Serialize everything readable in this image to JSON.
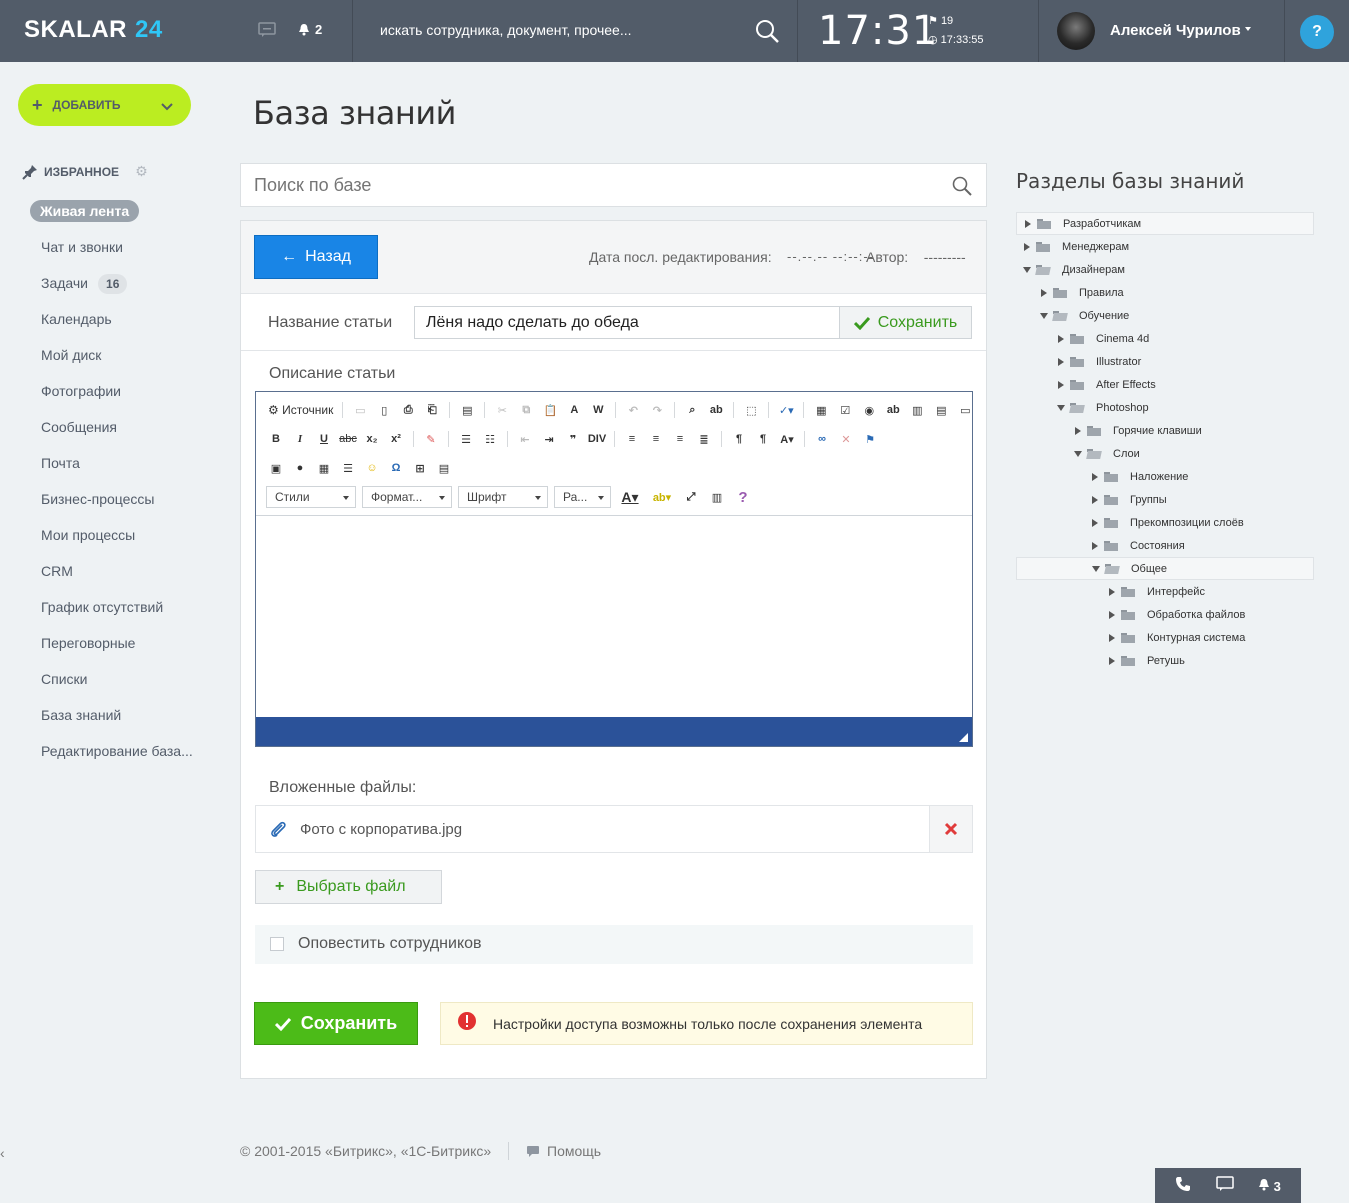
{
  "header": {
    "logo_text": "SKALAR",
    "logo_number": "24",
    "notifications_count": "2",
    "search_placeholder": "искать сотрудника, документ, прочее...",
    "clock": "17:31",
    "flag_count": "19",
    "timer": "17:33:55",
    "user_name": "Алексей Чурилов",
    "help_label": "?"
  },
  "sidebar": {
    "add_button": "ДОБАВИТЬ",
    "favorites_label": "ИЗБРАННОЕ",
    "items": [
      {
        "label": "Живая лента",
        "active": true
      },
      {
        "label": "Чат и звонки"
      },
      {
        "label": "Задачи",
        "counter": "16"
      },
      {
        "label": "Календарь"
      },
      {
        "label": "Мой диск"
      },
      {
        "label": "Фотографии"
      },
      {
        "label": "Сообщения"
      },
      {
        "label": "Почта"
      },
      {
        "label": "Бизнес-процессы"
      },
      {
        "label": "Мои процессы"
      },
      {
        "label": "CRM"
      },
      {
        "label": "График отсутствий"
      },
      {
        "label": "Переговорные"
      },
      {
        "label": "Списки"
      },
      {
        "label": "База знаний"
      },
      {
        "label": "Редактирование база..."
      }
    ]
  },
  "main": {
    "title": "База знаний",
    "search_placeholder": "Поиск по базе",
    "back_button": "Назад",
    "last_edit_label": "Дата посл. редактирования:",
    "last_edit_value": "--.--.-- --:--:--",
    "author_label": "Автор:",
    "author_value": "---------",
    "article_title_label": "Название статьи",
    "article_title_value": "Лёня надо сделать до обеда",
    "save_small": "Сохранить",
    "description_label": "Описание статьи",
    "editor": {
      "source_label": "Источник",
      "styles": "Стили",
      "format": "Формат...",
      "font": "Шрифт",
      "size": "Ра..."
    },
    "attached_label": "Вложенные файлы:",
    "file_name": "Фото с корпоратива.jpg",
    "choose_file": "Выбрать файл",
    "notify_label": "Оповестить сотрудников",
    "save_big": "Сохранить",
    "warning_text": "Настройки доступа возможны только после сохранения элемента"
  },
  "tree": {
    "title": "Разделы базы знаний",
    "nodes": [
      {
        "label": "Разработчикам",
        "level": 0,
        "open": false,
        "highlight": true
      },
      {
        "label": "Менеджерам",
        "level": 0,
        "open": false
      },
      {
        "label": "Дизайнерам",
        "level": 0,
        "open": true
      },
      {
        "label": "Правила",
        "level": 1,
        "open": false
      },
      {
        "label": "Обучение",
        "level": 1,
        "open": true
      },
      {
        "label": "Cinema 4d",
        "level": 2,
        "open": false
      },
      {
        "label": "Illustrator",
        "level": 2,
        "open": false
      },
      {
        "label": "After Effects",
        "level": 2,
        "open": false
      },
      {
        "label": "Photoshop",
        "level": 2,
        "open": true
      },
      {
        "label": "Горячие клавиши",
        "level": 3,
        "open": false
      },
      {
        "label": "Слои",
        "level": 3,
        "open": true
      },
      {
        "label": "Наложение",
        "level": 4,
        "open": false
      },
      {
        "label": "Группы",
        "level": 4,
        "open": false
      },
      {
        "label": "Прекомпозиции слоёв",
        "level": 4,
        "open": false
      },
      {
        "label": "Состояния",
        "level": 4,
        "open": false
      },
      {
        "label": "Общее",
        "level": 4,
        "open": true,
        "highlight": true
      },
      {
        "label": "Интерфейс",
        "level": 5,
        "open": false
      },
      {
        "label": "Обработка файлов",
        "level": 5,
        "open": false
      },
      {
        "label": "Контурная система",
        "level": 5,
        "open": false
      },
      {
        "label": "Ретушь",
        "level": 5,
        "open": false
      }
    ]
  },
  "footer": {
    "copyright": "© 2001-2015 «Битрикс», «1С-Битрикс»",
    "help": "Помощь",
    "bottom_notifications": "3"
  },
  "colors": {
    "header_bg": "#525c69",
    "accent_green": "#bbed21",
    "primary_blue": "#1985e6",
    "save_green": "#4cbb18",
    "editor_footer": "#2b5299"
  }
}
